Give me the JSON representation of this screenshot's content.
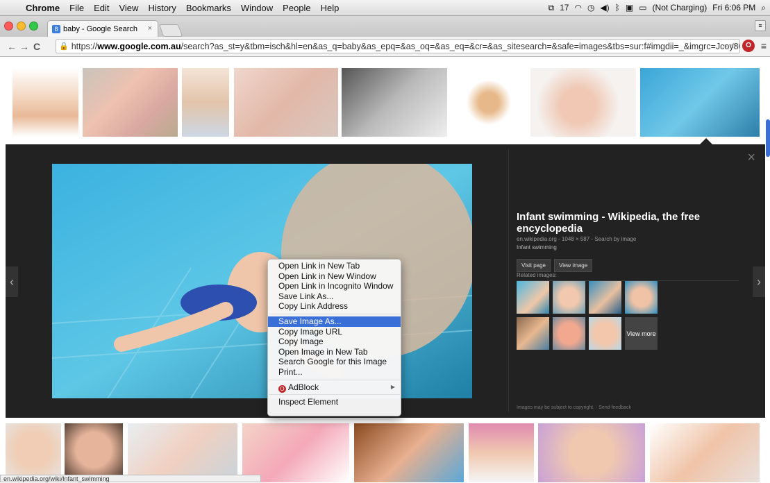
{
  "menubar": {
    "app": "Chrome",
    "items": [
      "File",
      "Edit",
      "View",
      "History",
      "Bookmarks",
      "Window",
      "People",
      "Help"
    ],
    "status_icons": {
      "adobe_count": "17"
    },
    "battery": "(Not Charging)",
    "clock": "Fri 6:06 PM"
  },
  "tab": {
    "title": "baby - Google Search"
  },
  "toolbar": {
    "url_prefix": "https://",
    "url_domain": "www.google.com.au",
    "url_rest": "/search?as_st=y&tbm=isch&hl=en&as_q=baby&as_epq=&as_oq=&as_eq=&cr=&as_sitesearch=&safe=images&tbs=sur:f#imgdii=_&imgrc=Jcoy80..."
  },
  "preview": {
    "title": "Infant swimming - Wikipedia, the free encyclopedia",
    "meta": "en.wikipedia.org - 1048 × 587 - Search by image",
    "caption": "Infant swimming",
    "visit_btn": "Visit page",
    "view_btn": "View image",
    "related_label": "Related images:",
    "view_more": "View more",
    "footer": "Images may be subject to copyright. - Send feedback"
  },
  "context_menu": {
    "group1": [
      "Open Link in New Tab",
      "Open Link in New Window",
      "Open Link in Incognito Window",
      "Save Link As...",
      "Copy Link Address"
    ],
    "group2": [
      "Save Image As...",
      "Copy Image URL",
      "Copy Image",
      "Open Image in New Tab",
      "Search Google for this Image",
      "Print..."
    ],
    "adblock": "AdBlock",
    "inspect": "Inspect Element"
  },
  "status_bar": "en.wikipedia.org/wiki/Infant_swimming",
  "colors": {
    "highlight": "#3b6fd8",
    "panel": "#222222"
  }
}
